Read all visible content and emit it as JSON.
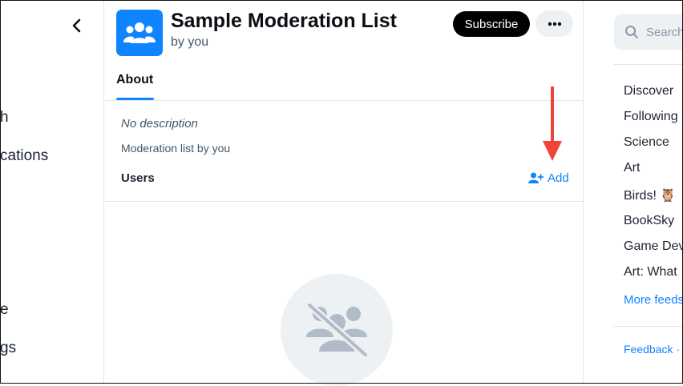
{
  "left_nav": {
    "items": [
      {
        "label": "Search",
        "visible_fragment": "h"
      },
      {
        "label": "Notifications",
        "visible_fragment": "cations"
      },
      {
        "label": "Profile",
        "visible_fragment": "e"
      },
      {
        "label": "Settings",
        "visible_fragment": "gs"
      }
    ]
  },
  "list": {
    "title": "Sample Moderation List",
    "owner": "by you",
    "subscribe_label": "Subscribe",
    "more_label": "•••",
    "tab_about": "About",
    "description": "No description",
    "meta": "Moderation list by you",
    "users_label": "Users",
    "add_label": "Add"
  },
  "right": {
    "search_placeholder": "Search",
    "feeds": [
      "Discover",
      "Following",
      "Science",
      "Art",
      "Birds! 🦉",
      "BookSky",
      "Game Dev",
      "Art: What"
    ],
    "more_feeds": "More feeds",
    "feedback": "Feedback ·"
  },
  "colors": {
    "accent": "#1083fe",
    "arrow": "#f0433a",
    "text": "#0b0f14",
    "muted": "#42576c",
    "empty_icon": "#b1bcc8"
  }
}
